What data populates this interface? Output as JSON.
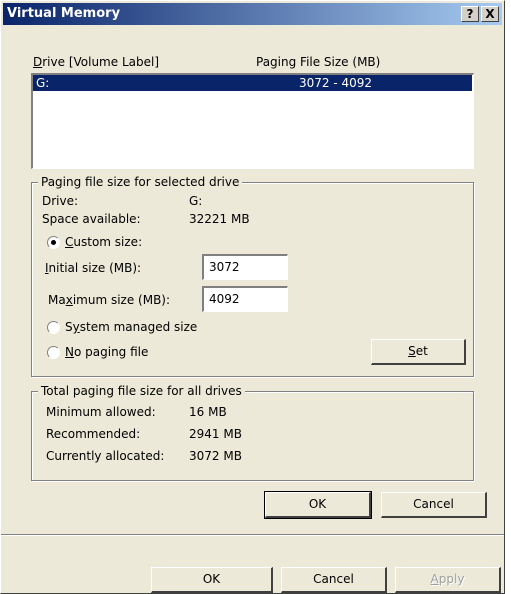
{
  "window": {
    "title": "Virtual Memory",
    "help_btn": "?",
    "close_btn": "X"
  },
  "list": {
    "col_drive": "Drive  [Volume Label]",
    "col_drive_hotkey": "D",
    "col_drive_rest": "rive  [Volume Label]",
    "col_size": "Paging File Size (MB)",
    "rows": [
      {
        "drive": "G:",
        "size": "3072 - 4092",
        "selected": true
      }
    ]
  },
  "selected_drive": {
    "legend": "Paging file size for selected drive",
    "drive_label": "Drive:",
    "drive_value": "G:",
    "space_label": "Space available:",
    "space_value": "32221 MB",
    "custom_hotkey": "C",
    "custom_rest": "ustom size:",
    "initial_hotkey": "I",
    "initial_rest": "nitial size (MB):",
    "initial_value": "3072",
    "max_pre": "Ma",
    "max_hotkey": "x",
    "max_rest": "imum size (MB):",
    "max_value": "4092",
    "system_pre": "S",
    "system_hotkey": "y",
    "system_rest": "stem managed size",
    "nopage_hotkey": "N",
    "nopage_rest": "o paging file",
    "set_hotkey": "S",
    "set_rest": "et",
    "selected_option": "custom"
  },
  "totals": {
    "legend": "Total paging file size for all drives",
    "min_label": "Minimum allowed:",
    "min_value": "16 MB",
    "rec_label": "Recommended:",
    "rec_value": "2941 MB",
    "cur_label": "Currently allocated:",
    "cur_value": "3072 MB"
  },
  "buttons": {
    "ok": "OK",
    "cancel": "Cancel",
    "ok2": "OK",
    "cancel2": "Cancel",
    "apply_hotkey": "A",
    "apply_rest": "pply"
  }
}
